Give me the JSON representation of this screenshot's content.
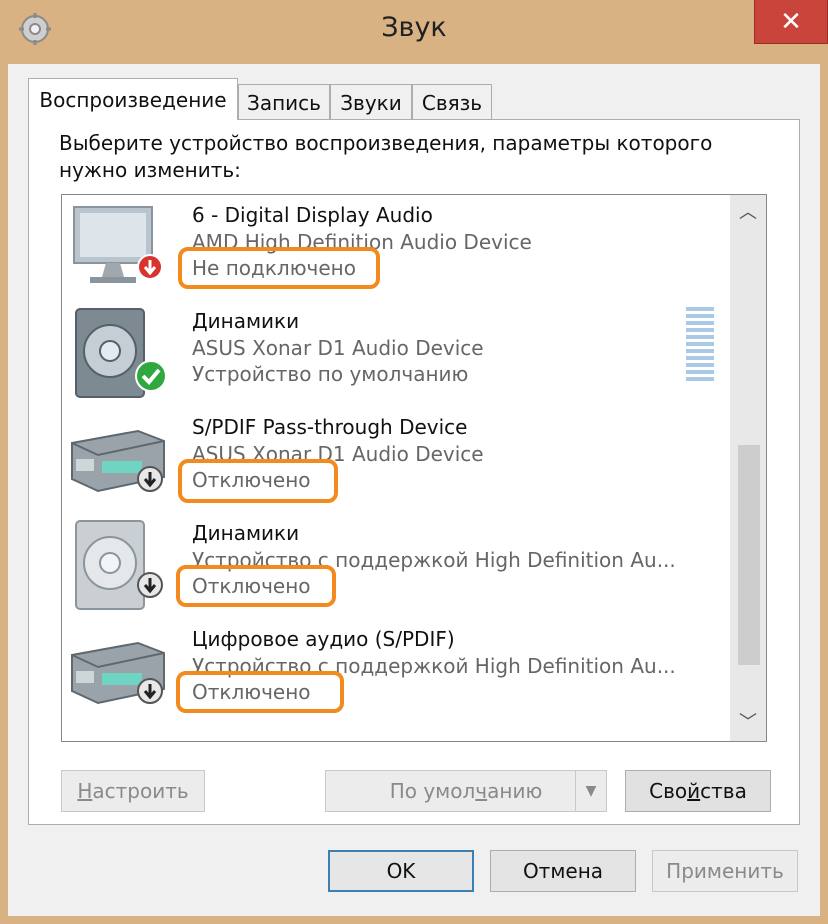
{
  "window": {
    "title": "Звук",
    "close_label": "✕"
  },
  "tabs": [
    {
      "label": "Воспроизведение",
      "active": true
    },
    {
      "label": "Запись",
      "active": false
    },
    {
      "label": "Звуки",
      "active": false
    },
    {
      "label": "Связь",
      "active": false
    }
  ],
  "instruction": "Выберите устройство воспроизведения, параметры которого нужно изменить:",
  "devices": [
    {
      "name": "6 - Digital Display Audio",
      "description": "AMD High Definition Audio Device",
      "status": "Не подключено",
      "icon": "monitor-icon",
      "badge": "red-down-arrow-icon"
    },
    {
      "name": "Динамики",
      "description": "ASUS Xonar D1 Audio Device",
      "status": "Устройство по умолчанию",
      "icon": "speaker-icon",
      "badge": "green-check-icon"
    },
    {
      "name": "S/PDIF Pass-through Device",
      "description": "ASUS Xonar D1 Audio Device",
      "status": "Отключено",
      "icon": "receiver-icon",
      "badge": "gray-down-arrow-icon"
    },
    {
      "name": "Динамики",
      "description": "Устройство с поддержкой High Definition Au...",
      "status": "Отключено",
      "icon": "speaker-icon",
      "badge": "gray-down-arrow-icon"
    },
    {
      "name": "Цифровое аудио (S/PDIF)",
      "description": "Устройство с поддержкой High Definition Au...",
      "status": "Отключено",
      "icon": "receiver-icon",
      "badge": "gray-down-arrow-icon"
    }
  ],
  "buttons": {
    "configure": {
      "prefix": "",
      "hotkey": "Н",
      "rest": "астроить"
    },
    "set_default": {
      "prefix": "По умол",
      "hotkey": "ч",
      "rest": "анию"
    },
    "properties": {
      "prefix": "Сво",
      "hotkey": "й",
      "rest": "ства"
    },
    "ok": "OK",
    "cancel": "Отмена",
    "apply": "Применить"
  },
  "colors": {
    "highlight": "#f28a1d",
    "close": "#c9443a",
    "frame": "#d8b283"
  }
}
